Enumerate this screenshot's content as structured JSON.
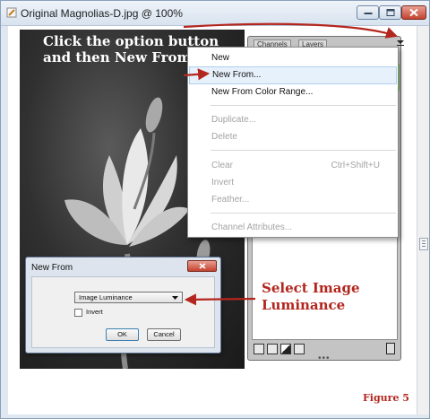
{
  "window": {
    "title": "Original Magnolias-D.jpg @ 100%"
  },
  "instructions": {
    "click_option": "Click the option button and then New From.",
    "select_luminance": "Select Image Luminance",
    "figure_label": "Figure 5"
  },
  "panel": {
    "tabs": [
      "Channels",
      "Layers"
    ]
  },
  "menu": {
    "items": [
      {
        "label": "New",
        "shortcut": "",
        "enabled": true
      },
      {
        "label": "New From...",
        "shortcut": "",
        "enabled": true
      },
      {
        "label": "New From Color Range...",
        "shortcut": "",
        "enabled": true
      },
      {
        "label": "Duplicate...",
        "shortcut": "",
        "enabled": false
      },
      {
        "label": "Delete",
        "shortcut": "",
        "enabled": false
      },
      {
        "label": "Clear",
        "shortcut": "Ctrl+Shift+U",
        "enabled": false
      },
      {
        "label": "Invert",
        "shortcut": "",
        "enabled": false
      },
      {
        "label": "Feather...",
        "shortcut": "",
        "enabled": false
      },
      {
        "label": "Channel Attributes...",
        "shortcut": "",
        "enabled": false
      }
    ]
  },
  "dialog": {
    "title": "New From",
    "select_value": "Image Luminance",
    "invert_label": "Invert",
    "invert_checked": false,
    "ok_label": "OK",
    "cancel_label": "Cancel"
  },
  "colors": {
    "annotation_red": "#b3261e",
    "highlight": "#e7f1fb"
  },
  "icons": {
    "title": "paint-document-icon",
    "minimize": "minimize-icon",
    "maximize": "maximize-icon",
    "close": "close-icon",
    "option": "panel-options-icon",
    "trash": "trash-icon"
  }
}
